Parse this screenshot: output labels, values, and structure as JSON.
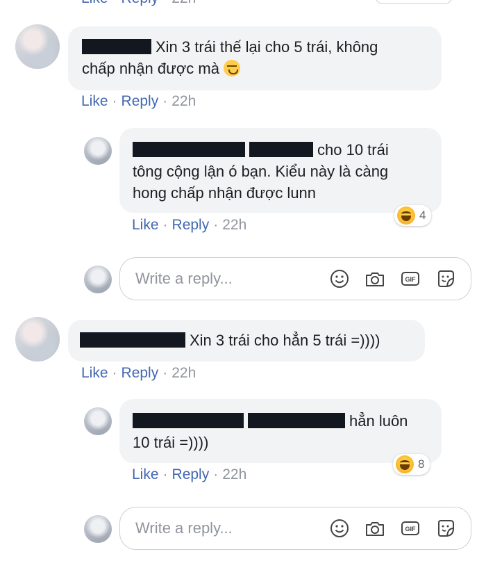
{
  "top_partial": {
    "like": "Like",
    "reply": "Reply",
    "time": "22h"
  },
  "comments": [
    {
      "text": "Xin 3 trái thế lại cho 5 trái, không chấp nhận được mà",
      "line1": "Xin 3 trái thế lại cho 5 trái, không",
      "line2": "chấp nhận được mà",
      "actions": {
        "like": "Like",
        "reply": "Reply",
        "time": "22h"
      },
      "reply": {
        "line1": "cho 10 trái",
        "line2": "tông cộng lận ó bạn. Kiểu này là càng",
        "line3": "hong chấp nhận được lunn",
        "reaction": {
          "icon": "haha-icon",
          "count": "4"
        },
        "actions": {
          "like": "Like",
          "reply": "Reply",
          "time": "22h"
        }
      },
      "reply_box": {
        "placeholder": "Write a reply..."
      }
    },
    {
      "line1": "Xin 3 trái cho hẳn 5 trái =))))",
      "actions": {
        "like": "Like",
        "reply": "Reply",
        "time": "22h"
      },
      "reply": {
        "line1": "hẳn luôn",
        "line2": "10 trái =))))",
        "reaction": {
          "icon": "haha-icon",
          "count": "8"
        },
        "actions": {
          "like": "Like",
          "reply": "Reply",
          "time": "22h"
        }
      },
      "reply_box": {
        "placeholder": "Write a reply..."
      }
    }
  ],
  "icons": [
    "emoji-icon",
    "camera-icon",
    "gif-icon",
    "sticker-icon"
  ],
  "colors": {
    "link": "#4267b2",
    "meta": "#90949c",
    "bubble": "#f2f3f5",
    "border": "#ccd0d5"
  }
}
